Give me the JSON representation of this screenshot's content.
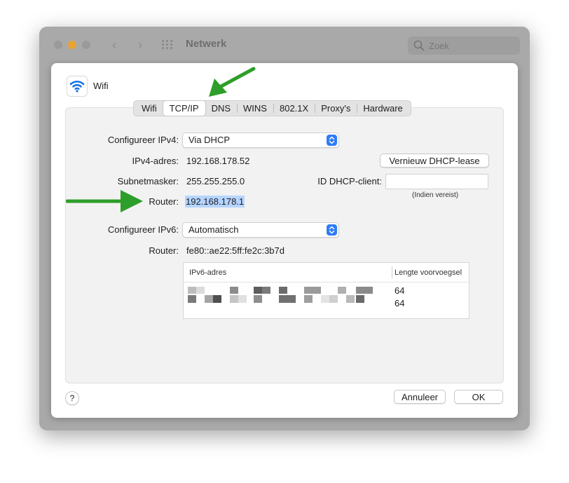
{
  "window": {
    "title": "Netwerk",
    "search_placeholder": "Zoek"
  },
  "sheet": {
    "service_name": "Wifi",
    "tabs": [
      {
        "label": "Wifi"
      },
      {
        "label": "TCP/IP",
        "active": true
      },
      {
        "label": "DNS"
      },
      {
        "label": "WINS"
      },
      {
        "label": "802.1X"
      },
      {
        "label": "Proxy's"
      },
      {
        "label": "Hardware"
      }
    ]
  },
  "tcpip": {
    "configure_ipv4_label": "Configureer IPv4:",
    "configure_ipv4_value": "Via DHCP",
    "ipv4_address_label": "IPv4-adres:",
    "ipv4_address": "192.168.178.52",
    "subnet_mask_label": "Subnetmasker:",
    "subnet_mask": "255.255.255.0",
    "router_label": "Router:",
    "router": "192.168.178.1",
    "renew_button": "Vernieuw DHCP-lease",
    "dhcp_client_id_label": "ID DHCP-client:",
    "dhcp_client_id_value": "",
    "dhcp_client_id_hint": "(Indien vereist)",
    "configure_ipv6_label": "Configureer IPv6:",
    "configure_ipv6_value": "Automatisch",
    "ipv6_router_label": "Router:",
    "ipv6_router": "fe80::ae22:5ff:fe2c:3b7d",
    "ipv6_table": {
      "columns": [
        "IPv6-adres",
        "Lengte voorvoegsel"
      ],
      "rows": [
        {
          "address": "",
          "prefix_length": "64"
        },
        {
          "address": "",
          "prefix_length": "64"
        }
      ]
    }
  },
  "footer": {
    "help": "?",
    "cancel": "Annuleer",
    "ok": "OK"
  },
  "colors": {
    "accent": "#2f7cf6",
    "selection": "#b5d5ff",
    "annotation_arrow": "#2e9e2a"
  }
}
